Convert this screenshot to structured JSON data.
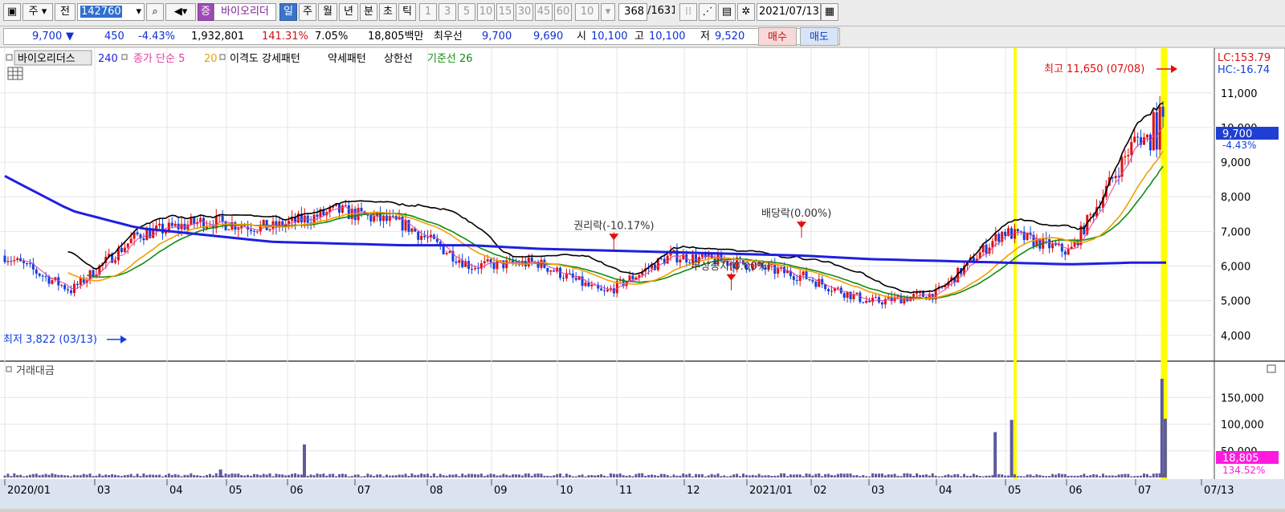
{
  "toolbar": {
    "market": "주",
    "prev": "전",
    "code": "142760",
    "type_badge": "증",
    "stock_name": "바이오리더",
    "periods": [
      "일",
      "주",
      "월",
      "년",
      "분",
      "초",
      "틱"
    ],
    "active_period": "일",
    "intervals": [
      "1",
      "3",
      "5",
      "10",
      "15",
      "30",
      "45",
      "60"
    ],
    "interval_value": "10",
    "count": "368",
    "total": "/1631",
    "date": "2021/07/13"
  },
  "quote": {
    "price": "9,700",
    "arrow": "▼",
    "change": "450",
    "change_pct": "-4.43%",
    "volume": "1,932,801",
    "volume_ratio": "141.31%",
    "turnover": "7.05%",
    "amount": "18,805백만",
    "best_label": "최우선",
    "best_ask": "9,700",
    "best_bid": "9,690",
    "open_label": "시",
    "open": "10,100",
    "high_label": "고",
    "high": "10,100",
    "low_label": "저",
    "low": "9,520",
    "buy": "매수",
    "sell": "매도"
  },
  "legend": {
    "name": "바이오리더스",
    "ma240": "240",
    "close": "종가 단순 5",
    "ma20": "20",
    "disparity": "이격도 강세패턴",
    "weak": "약세패턴",
    "upper": "상한선",
    "base": "기준선 26"
  },
  "price_panel": {
    "lc": "LC:153.79",
    "hc": "HC:-16.74",
    "last_price": "9,700",
    "last_pct": "-4.43%",
    "high_note": "최고 11,650 (07/08)",
    "low_note": "최저 3,822 (03/13)",
    "events": [
      {
        "label": "권리락(-10.17%)",
        "month_index": 8.95,
        "price": 6700
      },
      {
        "label": "무상증자(0.00%)",
        "month_index": 10.75,
        "price": 5530
      },
      {
        "label": "배당락(0.00%)",
        "month_index": 11.85,
        "price": 7050
      }
    ]
  },
  "volume_panel": {
    "title": "거래대금",
    "last": "18,805",
    "last_pct": "134.52%"
  },
  "colors": {
    "ma240": "#1f1fe0",
    "ma5": "#e040a0",
    "ma20": "#f0a000",
    "upper": "#000000",
    "base": "#138a13",
    "candle_up": "#e01010",
    "candle_down": "#1040e0",
    "volume": "#5e5b9c",
    "highlight": "#ffff00"
  },
  "chart_data": [
    {
      "type": "candlestick",
      "title": "바이오리더스",
      "x_axis": [
        "2020/01",
        "03",
        "04",
        "05",
        "06",
        "07",
        "08",
        "09",
        "10",
        "11",
        "12",
        "2021/01",
        "02",
        "03",
        "04",
        "05",
        "06",
        "07",
        "07/13"
      ],
      "y_ticks": [
        4000,
        5000,
        6000,
        7000,
        8000,
        9000,
        10000,
        11000
      ],
      "ylim": [
        3300,
        12200
      ],
      "close_monthly": [
        6300,
        5300,
        6900,
        7300,
        7100,
        7600,
        7200,
        6000,
        6100,
        5200,
        6300,
        6100,
        5700,
        4950,
        5200,
        7000,
        6400,
        9700
      ],
      "ma240_monthly": [
        8600,
        7600,
        7100,
        6900,
        6700,
        6650,
        6600,
        6600,
        6500,
        6450,
        6400,
        6350,
        6300,
        6200,
        6150,
        6100,
        6050,
        6100
      ],
      "high": {
        "value": 11650,
        "date": "07/08"
      },
      "low": {
        "value": 3822,
        "date": "03/13"
      },
      "last": {
        "value": 9700,
        "change_pct": -4.43
      }
    },
    {
      "type": "bar",
      "title": "거래대금",
      "y_ticks": [
        50000,
        100000,
        150000
      ],
      "ylim": [
        0,
        200000
      ],
      "spikes": [
        {
          "month_index": 2.9,
          "value": 15000
        },
        {
          "month_index": 4.25,
          "value": 62000
        },
        {
          "month_index": 14.85,
          "value": 85000
        },
        {
          "month_index": 15.1,
          "value": 108000
        },
        {
          "month_index": 17.4,
          "value": 185000
        },
        {
          "month_index": 17.45,
          "value": 110000
        }
      ],
      "last": {
        "value": 18805,
        "pct": 134.52
      }
    }
  ]
}
